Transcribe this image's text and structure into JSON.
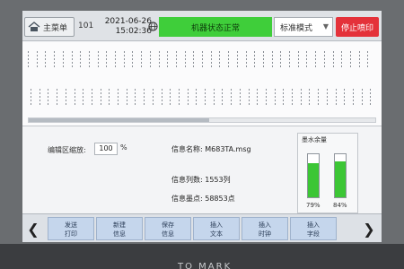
{
  "topbar": {
    "home_label": "主菜单",
    "counter": "101",
    "date": "2021-06-26",
    "time": "15:02:36",
    "status_text": "机器状态正常",
    "mode_value": "标准模式",
    "stop_label": "停止喷印",
    "colors": {
      "status": "#3fce3a",
      "stop": "#e4323a"
    }
  },
  "preview": {
    "scroll_position": 0.52
  },
  "info": {
    "zoom_label": "编辑区缩放:",
    "zoom_value": "100",
    "zoom_unit": "%",
    "message_name": "信息名称: M683TA.msg",
    "columns": "信息列数: 1553列",
    "dots": "信息墨点: 58853点"
  },
  "ink": {
    "title": "墨水余量",
    "levels": [
      {
        "percent_label": "79%",
        "level": 0.79
      },
      {
        "percent_label": "84%",
        "level": 0.84
      }
    ]
  },
  "funcbar": {
    "prev_icon": "chevron-left-icon",
    "next_icon": "chevron-right-icon",
    "buttons": [
      {
        "line1": "发送",
        "line2": "打印"
      },
      {
        "line1": "新建",
        "line2": "信息"
      },
      {
        "line1": "保存",
        "line2": "信息"
      },
      {
        "line1": "插入",
        "line2": "文本"
      },
      {
        "line1": "插入",
        "line2": "时钟"
      },
      {
        "line1": "插入",
        "line2": "字段"
      }
    ]
  },
  "bezel": {
    "brand": "TO MARK"
  }
}
